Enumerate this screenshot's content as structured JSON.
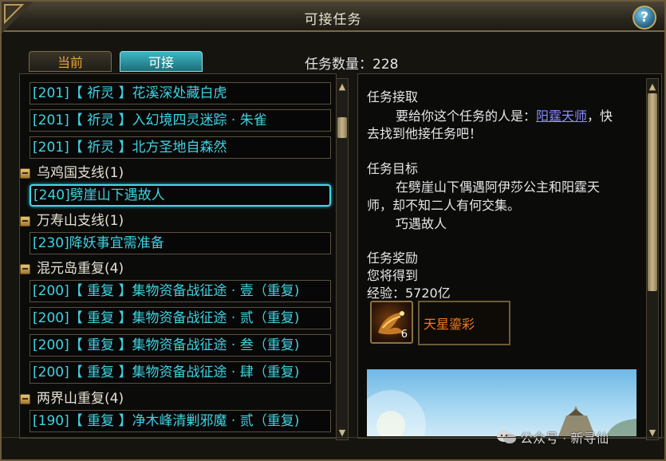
{
  "window": {
    "title": "可接任务"
  },
  "tabs": [
    {
      "label": "当前"
    },
    {
      "label": "可接"
    }
  ],
  "quest_count": "任务数量：228",
  "quest_list": {
    "rows": [
      {
        "text": "[201]【 祈灵 】花溪深处藏白虎"
      },
      {
        "text": "[201]【 祈灵 】入幻境四灵迷踪 · 朱雀"
      },
      {
        "text": "[201]【 祈灵 】北方圣地自森然"
      },
      {
        "text": "[240]劈崖山下遇故人"
      },
      {
        "text": "[230]降妖事宜需准备"
      },
      {
        "text": "[200]【 重复 】集物资备战征途 · 壹（重复)"
      },
      {
        "text": "[200]【 重复 】集物资备战征途 · 贰（重复)"
      },
      {
        "text": "[200]【 重复 】集物资备战征途 · 叁（重复)"
      },
      {
        "text": "[200]【 重复 】集物资备战征途 · 肆（重复)"
      },
      {
        "text": "[190]【 重复 】净木峰清剿邪魔 · 贰（重复)"
      }
    ],
    "groups": [
      {
        "label": "乌鸡国支线(1)"
      },
      {
        "label": "万寿山支线(1)"
      },
      {
        "label": "混元岛重复(4)"
      },
      {
        "label": "两界山重复(4)"
      }
    ]
  },
  "detail": {
    "accept_heading": "任务接取",
    "accept_line1": "要给你这个任务的人是：",
    "npc_name": "阳霆天师",
    "accept_line1_tail": "，快",
    "accept_line2": "去找到他接任务吧！",
    "goal_heading": "任务目标",
    "goal_line1": "在劈崖山下偶遇阿伊莎公主和阳霆天",
    "goal_line2": "师，却不知二人有何交集。",
    "goal_line3": "巧遇故人",
    "reward_heading": "任务奖励",
    "reward_intro": "您将得到",
    "reward_exp": "经验：5720亿",
    "reward_item_qty": "6",
    "reward_item_name": "天星鎏彩"
  },
  "watermark": "公众号 · 新寻仙",
  "colors": {
    "quest_text": "#3fd2e0",
    "npc_link": "#8d8bff",
    "reward_item": "#f07a1d",
    "tab_active": "#2a9aa6"
  },
  "icons": {
    "help": "question-mark-icon",
    "group_toggle": "collapse-minus-icon",
    "reward": "dragon-item-icon",
    "watermark": "wechat-icon"
  }
}
